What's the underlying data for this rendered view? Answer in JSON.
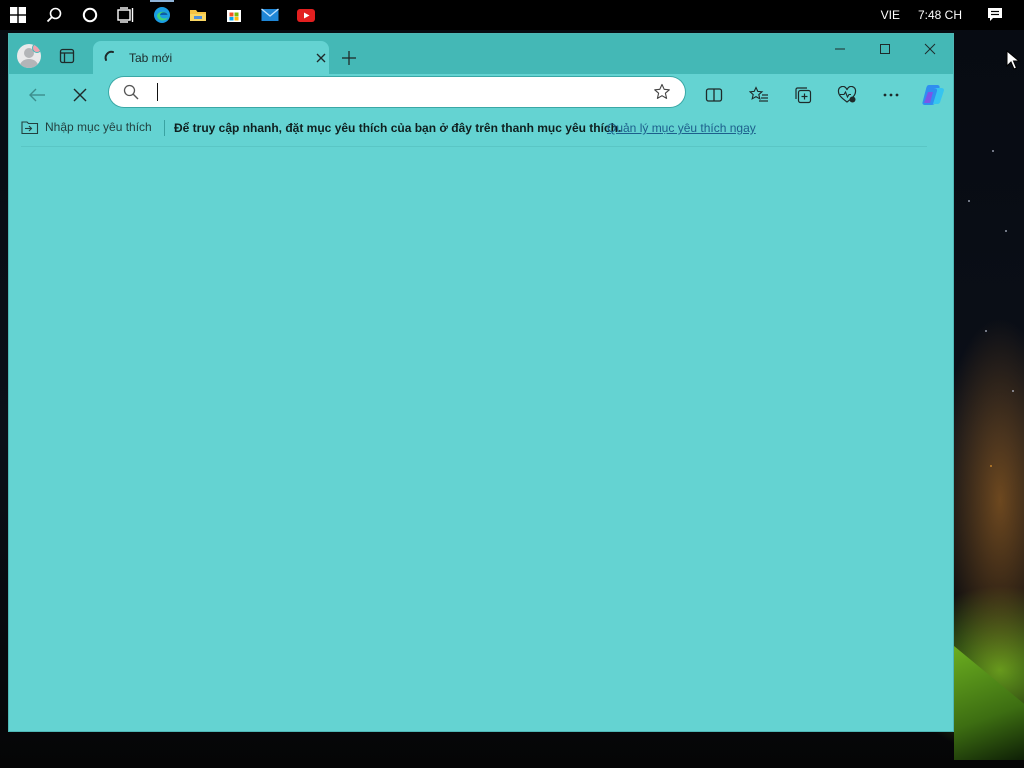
{
  "taskbar": {
    "icons": [
      "windows-start-icon",
      "search-icon",
      "cortana-icon",
      "task-view-icon",
      "edge-icon",
      "file-explorer-icon",
      "store-icon",
      "mail-icon",
      "youtube-icon"
    ],
    "language": "VIE",
    "time": "7:48 CH"
  },
  "browser": {
    "tab": {
      "title": "Tab mới"
    },
    "address": {
      "value": "",
      "placeholder": ""
    },
    "favorites_bar": {
      "import_label": "Nhập mục yêu thích",
      "hint": "Để truy cập nhanh, đặt mục yêu thích của bạn ở đây trên thanh mục yêu thích.",
      "manage_link": "Quản lý mục yêu thích ngay"
    },
    "theme_color": "#64d3d2",
    "titlebar_color": "#44b8b6"
  }
}
